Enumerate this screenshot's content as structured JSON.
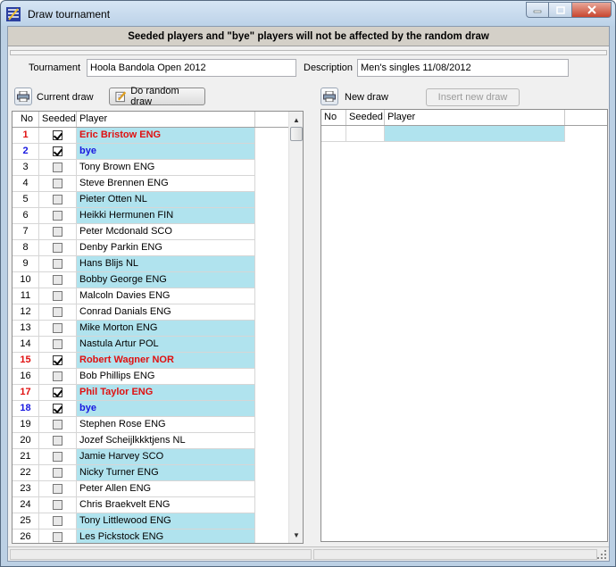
{
  "window": {
    "title": "Draw tournament",
    "icons": {
      "app": "draw-app-icon",
      "minimize": "minimize-icon",
      "maximize": "maximize-icon",
      "close": "close-icon"
    }
  },
  "banner": "Seeded players and \"bye\" players will not be affected by the random draw",
  "form": {
    "tournament_label": "Tournament",
    "tournament_value": "Hoola Bandola Open 2012",
    "description_label": "Description",
    "description_value": "Men's singles 11/08/2012"
  },
  "current": {
    "print_icon": "printer-icon",
    "label": "Current draw",
    "random_button": "Do random draw",
    "random_icon": "edit-pencil-icon",
    "headers": [
      "No",
      "Seeded",
      "Player"
    ],
    "rows": [
      {
        "no": "1",
        "seeded": true,
        "player": "Eric Bristow ENG",
        "style": "red"
      },
      {
        "no": "2",
        "seeded": true,
        "player": "bye",
        "style": "blue"
      },
      {
        "no": "3",
        "seeded": false,
        "player": "Tony Brown ENG",
        "style": "normal"
      },
      {
        "no": "4",
        "seeded": false,
        "player": "Steve Brennen ENG",
        "style": "normal"
      },
      {
        "no": "5",
        "seeded": false,
        "player": "Pieter Otten NL",
        "style": "normal"
      },
      {
        "no": "6",
        "seeded": false,
        "player": "Heikki Hermunen FIN",
        "style": "normal"
      },
      {
        "no": "7",
        "seeded": false,
        "player": "Peter Mcdonald SCO",
        "style": "normal"
      },
      {
        "no": "8",
        "seeded": false,
        "player": "Denby Parkin ENG",
        "style": "normal"
      },
      {
        "no": "9",
        "seeded": false,
        "player": "Hans Blijs NL",
        "style": "normal"
      },
      {
        "no": "10",
        "seeded": false,
        "player": "Bobby George ENG",
        "style": "normal"
      },
      {
        "no": "11",
        "seeded": false,
        "player": "Malcoln Davies ENG",
        "style": "normal"
      },
      {
        "no": "12",
        "seeded": false,
        "player": "Conrad Danials ENG",
        "style": "normal"
      },
      {
        "no": "13",
        "seeded": false,
        "player": "Mike Morton ENG",
        "style": "normal"
      },
      {
        "no": "14",
        "seeded": false,
        "player": "Nastula Artur POL",
        "style": "normal"
      },
      {
        "no": "15",
        "seeded": true,
        "player": "Robert Wagner NOR",
        "style": "red"
      },
      {
        "no": "16",
        "seeded": false,
        "player": "Bob Phillips ENG",
        "style": "normal"
      },
      {
        "no": "17",
        "seeded": true,
        "player": "Phil Taylor ENG",
        "style": "red"
      },
      {
        "no": "18",
        "seeded": true,
        "player": "bye",
        "style": "blue"
      },
      {
        "no": "19",
        "seeded": false,
        "player": "Stephen Rose ENG",
        "style": "normal"
      },
      {
        "no": "20",
        "seeded": false,
        "player": "Jozef Scheijlkkktjens NL",
        "style": "normal"
      },
      {
        "no": "21",
        "seeded": false,
        "player": "Jamie Harvey SCO",
        "style": "normal"
      },
      {
        "no": "22",
        "seeded": false,
        "player": "Nicky Turner ENG",
        "style": "normal"
      },
      {
        "no": "23",
        "seeded": false,
        "player": "Peter Allen ENG",
        "style": "normal"
      },
      {
        "no": "24",
        "seeded": false,
        "player": "Chris Braekvelt ENG",
        "style": "normal"
      },
      {
        "no": "25",
        "seeded": false,
        "player": "Tony Littlewood ENG",
        "style": "normal"
      },
      {
        "no": "26",
        "seeded": false,
        "player": "Les Pickstock ENG",
        "style": "normal"
      }
    ]
  },
  "newdraw": {
    "print_icon": "printer-icon",
    "label": "New draw",
    "insert_button": "Insert new draw",
    "headers": [
      "No",
      "Seeded",
      "Player"
    ]
  },
  "colors": {
    "row_highlight": "#b0e3ee",
    "seeded_red": "#e01010",
    "bye_blue": "#1818e0"
  }
}
